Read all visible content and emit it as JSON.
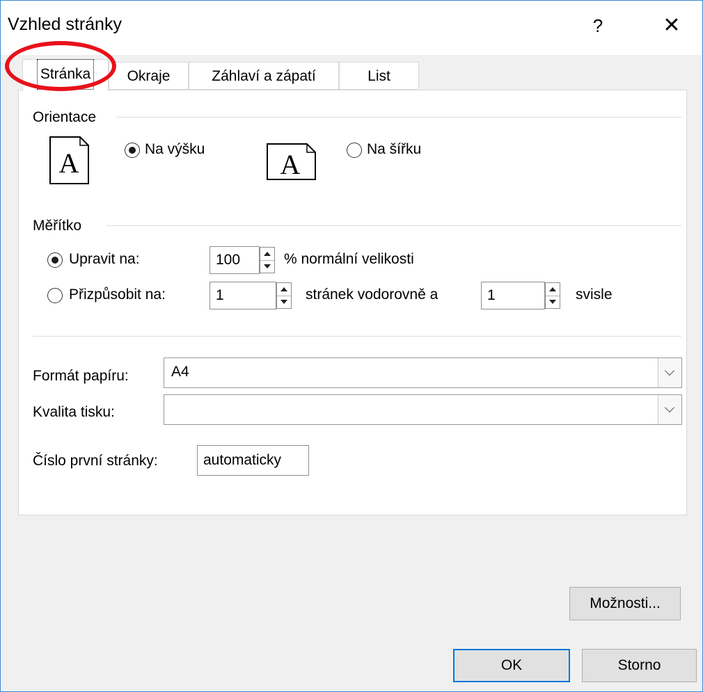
{
  "window": {
    "title": "Vzhled stránky",
    "help_label": "?",
    "close_label": "✕"
  },
  "tabs": [
    {
      "label": "Stránka",
      "active": true
    },
    {
      "label": "Okraje",
      "active": false
    },
    {
      "label": "Záhlaví a zápatí",
      "active": false
    },
    {
      "label": "List",
      "active": false
    }
  ],
  "orientation": {
    "section_label": "Orientace",
    "portrait_label": "Na výšku",
    "landscape_label": "Na šířku",
    "selected": "portrait",
    "page_glyph": "A"
  },
  "scale": {
    "section_label": "Měřítko",
    "adjust_label": "Upravit na:",
    "adjust_value": "100",
    "adjust_suffix": "% normální velikosti",
    "fit_label": "Přizpůsobit na:",
    "fit_wide_value": "1",
    "fit_wide_suffix": "stránek vodorovně a",
    "fit_tall_value": "1",
    "fit_tall_suffix": "svisle",
    "selected": "adjust"
  },
  "paper": {
    "format_label": "Formát papíru:",
    "format_value": "A4",
    "quality_label": "Kvalita tisku:",
    "quality_value": "",
    "first_page_label": "Číslo první stránky:",
    "first_page_value": "automaticky"
  },
  "buttons": {
    "options": "Možnosti...",
    "ok": "OK",
    "cancel": "Storno"
  },
  "colors": {
    "accent": "#0078d7",
    "highlight": "#e8111a"
  }
}
